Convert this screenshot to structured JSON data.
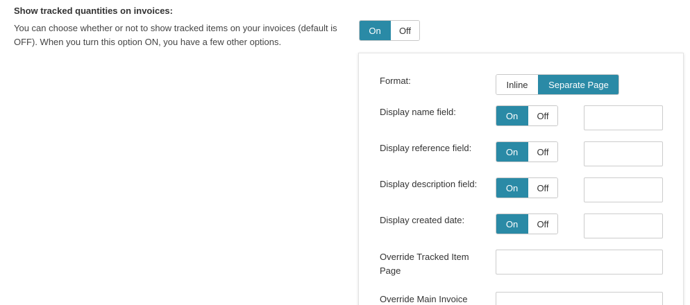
{
  "section": {
    "title": "Show tracked quantities on invoices:",
    "description": "You can choose whether or not to show tracked items on your invoices (default is OFF). When you turn this option ON, you have a few other options."
  },
  "main_toggle": {
    "on_label": "On",
    "off_label": "Off",
    "selected": "On"
  },
  "panel": {
    "format": {
      "label": "Format:",
      "options": [
        "Inline",
        "Separate Page"
      ],
      "selected": "Separate Page"
    },
    "rows": [
      {
        "label": "Display name field:",
        "on_label": "On",
        "off_label": "Off",
        "selected": "On",
        "input_value": ""
      },
      {
        "label": "Display reference field:",
        "on_label": "On",
        "off_label": "Off",
        "selected": "On",
        "input_value": ""
      },
      {
        "label": "Display description field:",
        "on_label": "On",
        "off_label": "Off",
        "selected": "On",
        "input_value": ""
      },
      {
        "label": "Display created date:",
        "on_label": "On",
        "off_label": "Off",
        "selected": "On",
        "input_value": ""
      }
    ],
    "override_tracked": {
      "label": "Override Tracked Item Page",
      "value": ""
    },
    "override_main": {
      "label": "Override Main Invoice",
      "value": ""
    }
  },
  "colors": {
    "accent": "#2a8aa6",
    "border": "#c8c8c8",
    "text": "#333333"
  }
}
